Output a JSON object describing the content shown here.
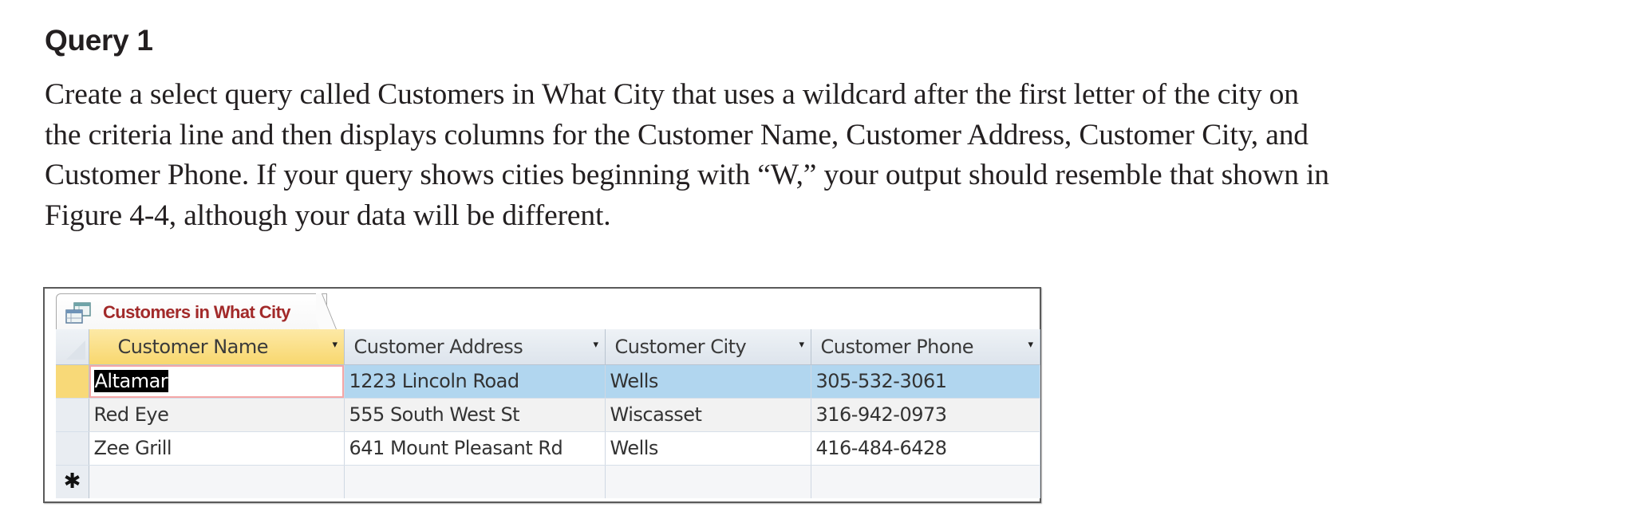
{
  "heading": "Query 1",
  "paragraph": {
    "lines": [
      "Create a select query called Customers in What City that uses a wildcard after the first letter of the city on",
      "the criteria line and then displays columns for the Customer Name, Customer Address, Customer City, and",
      "Customer Phone. If your query shows cities beginning with “W,” your output should resemble that shown in",
      "Figure 4-4, although your data will be different."
    ]
  },
  "figure": {
    "tab": {
      "icon": "query-icon",
      "label": "Customers in What City",
      "label_color": "#a22a2a"
    },
    "columns": [
      {
        "label": "Customer Name",
        "dropdown": "▾"
      },
      {
        "label": "Customer Address",
        "dropdown": "▾"
      },
      {
        "label": "Customer City",
        "dropdown": "▾"
      },
      {
        "label": "Customer Phone",
        "dropdown": "▾"
      }
    ],
    "rows": [
      {
        "name": "Altamar",
        "address": "1223 Lincoln Road",
        "city": "Wells",
        "phone": "305-532-3061"
      },
      {
        "name": "Red Eye",
        "address": "555 South West St",
        "city": "Wiscasset",
        "phone": "316-942-0973"
      },
      {
        "name": "Zee Grill",
        "address": "641 Mount Pleasant Rd",
        "city": "Wells",
        "phone": "416-484-6428"
      }
    ],
    "new_record_marker": "✱",
    "colors": {
      "active_header": "#f8d76e",
      "current_row": "#b1d6ef",
      "alt_row": "#f2f2f2"
    }
  }
}
